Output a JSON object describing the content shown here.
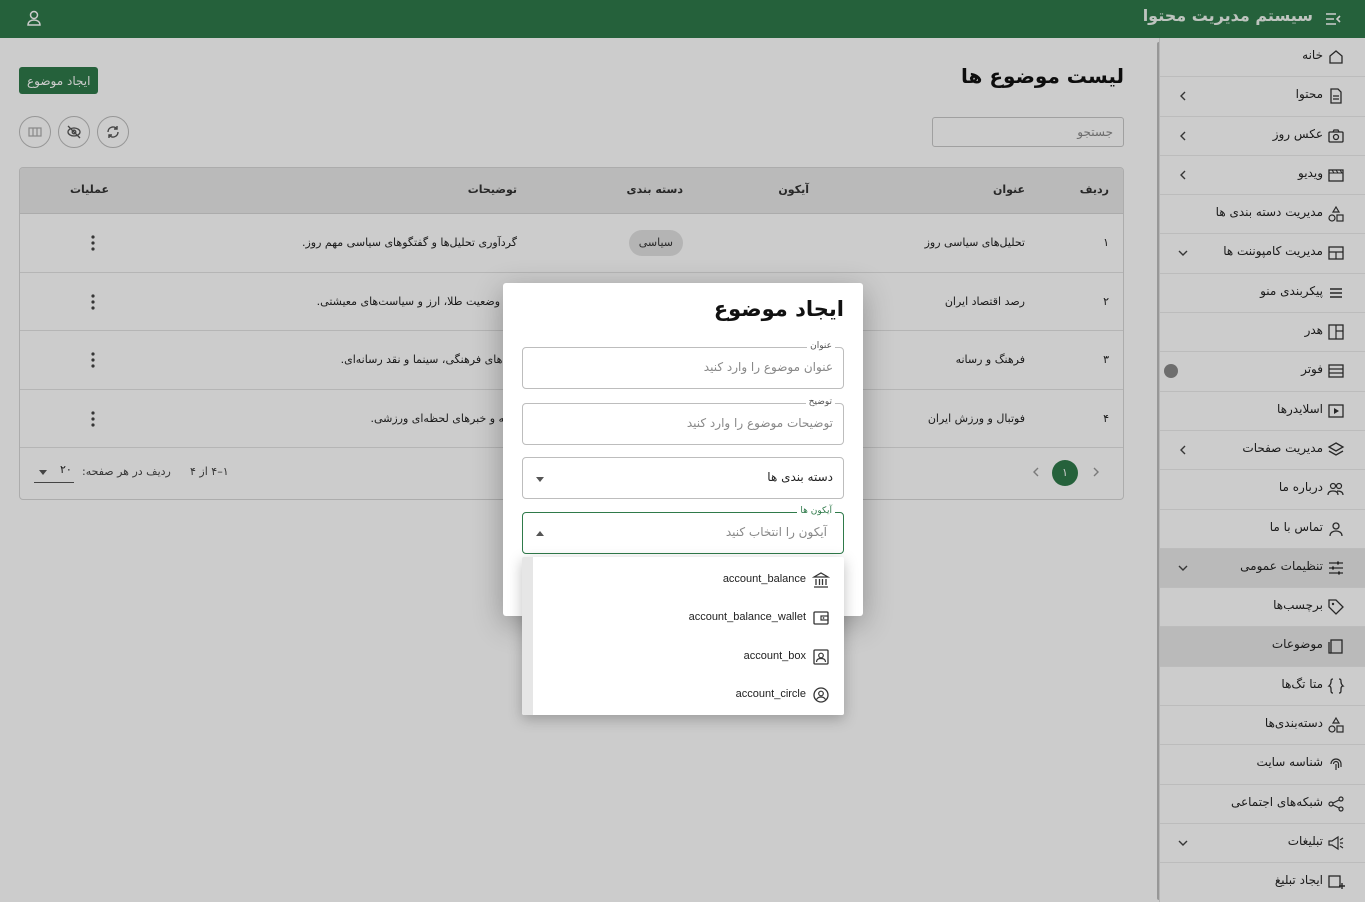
{
  "app": {
    "title": "سیستم مدیریت محتوا"
  },
  "sidebar": {
    "items": [
      {
        "label": "خانه",
        "icon": "home-icon"
      },
      {
        "label": "محتوا",
        "icon": "file-icon"
      },
      {
        "label": "عکس روز",
        "icon": "camera-icon"
      },
      {
        "label": "ویدیو",
        "icon": "video-icon"
      },
      {
        "label": "مدیریت دسته بندی ها",
        "icon": "category-icon"
      },
      {
        "label": "مدیریت کامپوننت ها",
        "icon": "grid-icon"
      },
      {
        "label": "پیکربندی منو",
        "icon": "menu-icon"
      },
      {
        "label": "هدر",
        "icon": "layout-icon"
      },
      {
        "label": "فوتر",
        "icon": "footer-icon"
      },
      {
        "label": "اسلایدرها",
        "icon": "slider-icon"
      },
      {
        "label": "مدیریت صفحات",
        "icon": "layers-icon"
      },
      {
        "label": "درباره ما",
        "icon": "people-icon"
      },
      {
        "label": "تماس با ما",
        "icon": "contact-icon"
      },
      {
        "label": "تنظیمات عمومی",
        "icon": "tune-icon"
      },
      {
        "label": "برچسب‌ها",
        "icon": "tag-icon"
      },
      {
        "label": "موضوعات",
        "icon": "topic-icon"
      },
      {
        "label": "متا تگ‌ها",
        "icon": "braces-icon"
      },
      {
        "label": "دسته‌بندی‌ها",
        "icon": "category-icon"
      },
      {
        "label": "شناسه سایت",
        "icon": "fingerprint-icon"
      },
      {
        "label": "شبکه‌های اجتماعی",
        "icon": "share-icon"
      },
      {
        "label": "تبلیغات",
        "icon": "campaign-icon"
      },
      {
        "label": "ایجاد تبلیغ",
        "icon": "add-box-icon"
      }
    ]
  },
  "main": {
    "title": "لیست موضوع ها",
    "create_label": "ایجاد موضوع",
    "search_placeholder": "جستجو",
    "columns": [
      "ردیف",
      "عنوان",
      "آیکون",
      "دسته بندی",
      "توضیحات",
      "عملیات"
    ],
    "rows": [
      {
        "index": "۱",
        "title": "تحلیل‌های سیاسی روز",
        "category": "سیاسی",
        "desc": "گردآوری تحلیل‌ها و گفتگوهای سیاسی مهم روز."
      },
      {
        "index": "۲",
        "title": "رصد اقتصاد ایران",
        "category": "",
        "desc": "ش وضعیت طلا، ارز و سیاست‌های معیشتی."
      },
      {
        "index": "۳",
        "title": "فرهنگ و رسانه",
        "category": "",
        "desc": "نده‌های فرهنگی، سینما و نقد رسانه‌ای."
      },
      {
        "index": "۴",
        "title": "فوتبال و ورزش ایران",
        "category": "",
        "desc": "شیه و خبرهای لحظه‌ای ورزشی."
      }
    ],
    "pagination": {
      "current": "۱",
      "range": "۱–۴ از ۴",
      "rows_per_page_label": "ردیف در هر صفحه:",
      "rows_per_page": "۲۰"
    }
  },
  "dialog": {
    "title": "ایجاد موضوع",
    "title_field": {
      "label": "عنوان",
      "placeholder": "عنوان موضوع را وارد کنید"
    },
    "desc_field": {
      "label": "توضیح",
      "placeholder": "توضیحات موضوع را وارد کنید"
    },
    "category_field": {
      "value": "دسته بندی ها"
    },
    "icon_field": {
      "label": "آیکون ها",
      "placeholder": "آیکون را انتخاب کنید"
    },
    "icon_options": [
      {
        "label": "account_balance",
        "icon": "bank-icon"
      },
      {
        "label": "account_balance_wallet",
        "icon": "wallet-icon"
      },
      {
        "label": "account_box",
        "icon": "account-box-icon"
      },
      {
        "label": "account_circle",
        "icon": "account-circle-icon"
      }
    ]
  },
  "colors": {
    "primary": "#2f7a4a",
    "overlay": "rgba(0,0,0,0.2)"
  }
}
